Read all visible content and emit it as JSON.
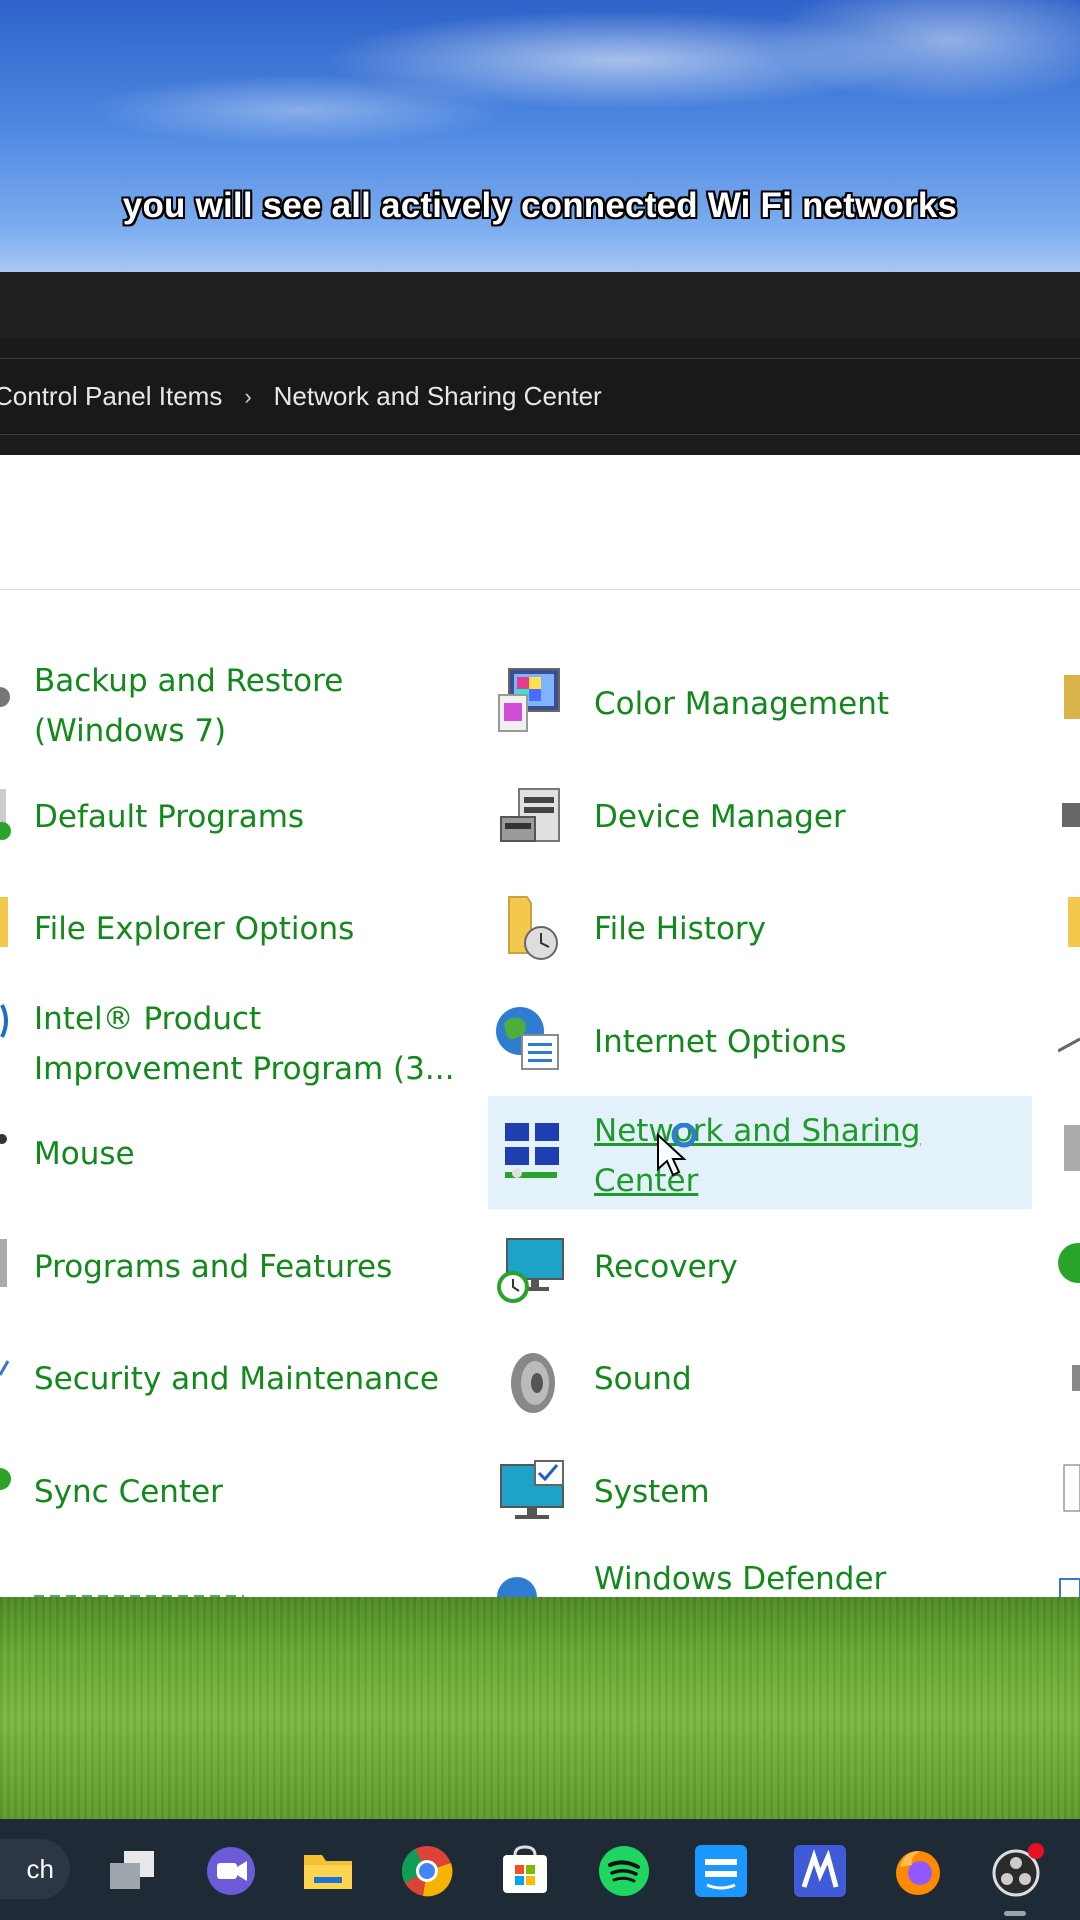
{
  "caption": "you will see all actively connected Wi Fi networks",
  "address_bar": {
    "crumbs": [
      "Control Panel Items",
      "Network and Sharing Center"
    ],
    "separator": "›"
  },
  "items": {
    "backup_line1": "Backup and Restore",
    "backup_line2": "(Windows 7)",
    "color_management": "Color Management",
    "default_programs": "Default Programs",
    "device_manager": "Device Manager",
    "file_explorer_options": "File Explorer Options",
    "file_history": "File History",
    "intel_line1": "Intel® Product",
    "intel_line2": "Improvement Program (3...",
    "internet_options": "Internet Options",
    "mouse": "Mouse",
    "network_line1": "Network and Sharing",
    "network_line2": "Center",
    "programs_features": "Programs and Features",
    "recovery": "Recovery",
    "security_maintenance": "Security and Maintenance",
    "sound": "Sound",
    "sync_center": "Sync Center",
    "system": "System",
    "windows_defender": "Windows Defender"
  },
  "taskbar": {
    "search_text": "ch",
    "apps": [
      "task-view",
      "meet",
      "file-explorer",
      "chrome",
      "microsoft-store",
      "spotify",
      "prime-video",
      "app-m",
      "firefox",
      "obs"
    ]
  },
  "colors": {
    "link_green": "#128a1b",
    "highlight": "#e3f1fb",
    "titlebar": "#202020",
    "taskbar": "#1e2a36"
  }
}
